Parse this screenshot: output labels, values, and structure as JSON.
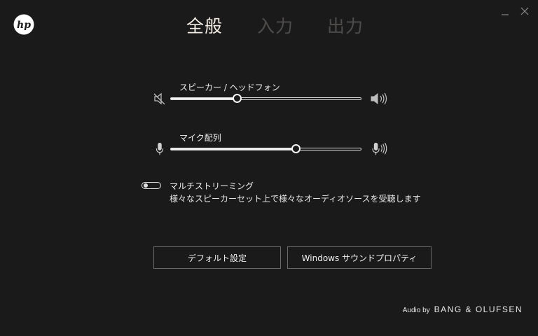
{
  "window": {
    "minimize_icon": "minimize-icon",
    "close_icon": "close-icon"
  },
  "logo": {
    "text": "hp"
  },
  "tabs": [
    {
      "label": "全般",
      "active": true
    },
    {
      "label": "入力",
      "active": false
    },
    {
      "label": "出力",
      "active": false
    }
  ],
  "speaker": {
    "label": "スピーカー / ヘッドフォン",
    "value_percent": 35,
    "icon_left": "speaker-muted-icon",
    "icon_right": "speaker-loud-icon"
  },
  "mic": {
    "label": "マイク配列",
    "value_percent": 66,
    "icon_left": "microphone-icon",
    "icon_right": "microphone-loud-icon"
  },
  "multistream": {
    "title": "マルチストリーミング",
    "description": "様々なスピーカーセット上で様々なオーディオソースを受聴します",
    "enabled": false
  },
  "buttons": {
    "default": "デフォルト設定",
    "windows_sound": "Windows サウンドプロパティ"
  },
  "brand": {
    "prefix": "Audio by",
    "name": "BANG & OLUFSEN"
  },
  "colors": {
    "background": "#1b1a1a",
    "active_tab": "#f2ece4",
    "inactive_tab": "#4f4d4b",
    "button_border": "#6a6867"
  }
}
